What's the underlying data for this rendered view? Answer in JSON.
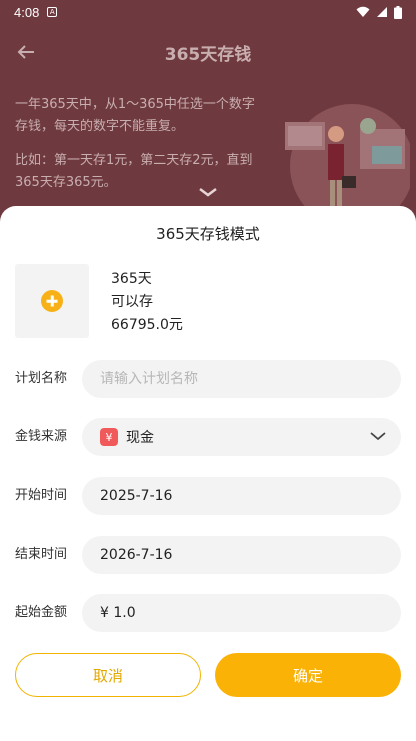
{
  "status_bar": {
    "time": "4:08"
  },
  "background": {
    "title": "365天存钱",
    "description_1": "一年365天中，从1～365中任选一个数字存钱，每天的数字不能重复。",
    "description_2": "比如：第一天存1元，第二天存2元，直到365天存365元。"
  },
  "sheet": {
    "title": "365天存钱模式",
    "plan": {
      "days": "365天",
      "can_save": "可以存",
      "amount": "66795.0元"
    },
    "fields": {
      "plan_name": {
        "label": "计划名称",
        "placeholder": "请输入计划名称",
        "value": ""
      },
      "money_source": {
        "label": "金钱来源",
        "icon": "¥",
        "value": "现金"
      },
      "start_time": {
        "label": "开始时间",
        "value": "2025-7-16"
      },
      "end_time": {
        "label": "结束时间",
        "value": "2026-7-16"
      },
      "start_amount": {
        "label": "起始金额",
        "value": "¥ 1.0"
      }
    },
    "cancel_label": "取消",
    "confirm_label": "确定"
  },
  "colors": {
    "accent": "#fab207",
    "cash_icon": "#f05a5a",
    "overlay_bg": "#6e3a3f"
  }
}
